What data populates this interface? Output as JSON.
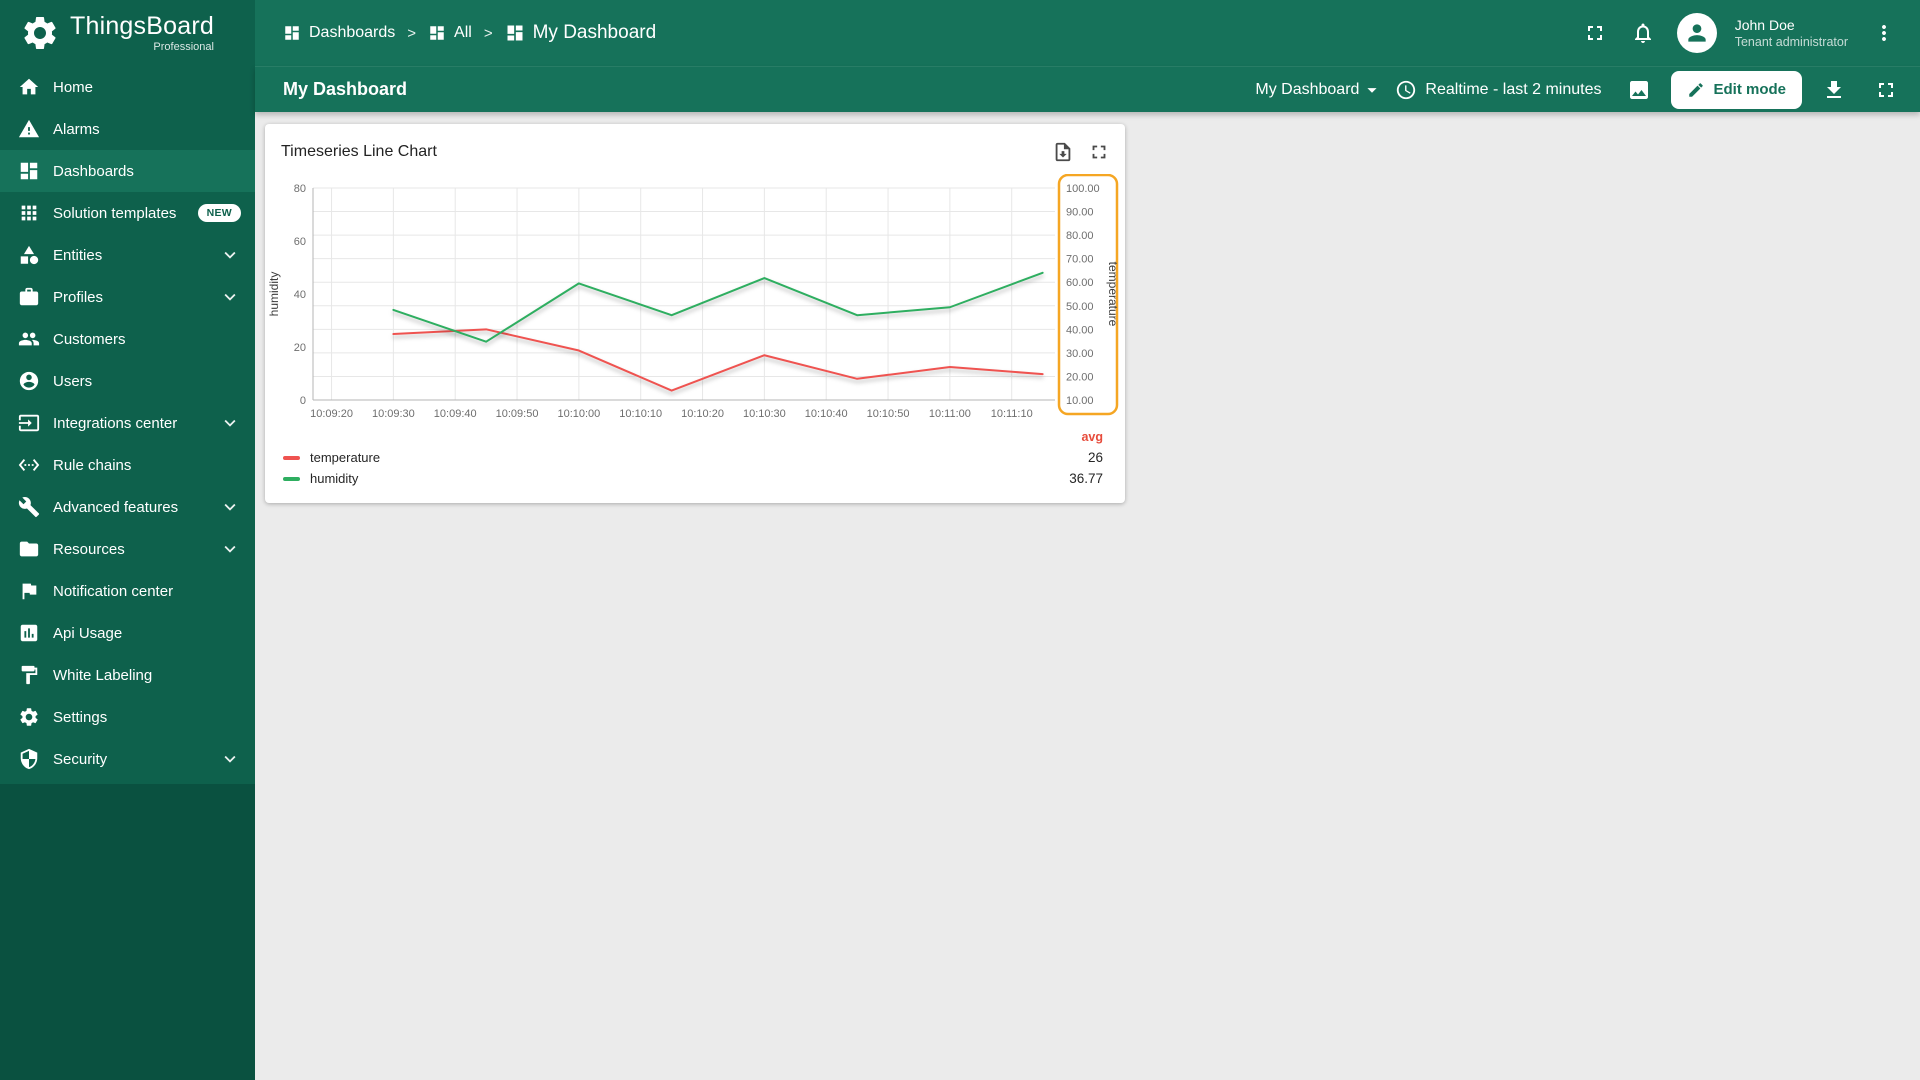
{
  "brand": {
    "name": "ThingsBoard",
    "edition": "Professional"
  },
  "sidebar": {
    "items": [
      {
        "label": "Home"
      },
      {
        "label": "Alarms"
      },
      {
        "label": "Dashboards",
        "active": true
      },
      {
        "label": "Solution templates",
        "badge": "NEW"
      },
      {
        "label": "Entities",
        "expandable": true
      },
      {
        "label": "Profiles",
        "expandable": true
      },
      {
        "label": "Customers"
      },
      {
        "label": "Users"
      },
      {
        "label": "Integrations center",
        "expandable": true
      },
      {
        "label": "Rule chains"
      },
      {
        "label": "Advanced features",
        "expandable": true
      },
      {
        "label": "Resources",
        "expandable": true
      },
      {
        "label": "Notification center"
      },
      {
        "label": "Api Usage"
      },
      {
        "label": "White Labeling"
      },
      {
        "label": "Settings"
      },
      {
        "label": "Security",
        "expandable": true
      }
    ]
  },
  "topbar": {
    "breadcrumb": [
      {
        "label": "Dashboards"
      },
      {
        "label": "All"
      },
      {
        "label": "My Dashboard"
      }
    ],
    "separator": ">",
    "user_name": "John Doe",
    "user_role": "Tenant administrator"
  },
  "dashboard_toolbar": {
    "title": "My Dashboard",
    "state_select": "My Dashboard",
    "timewindow": "Realtime - last 2 minutes",
    "edit_button": "Edit mode"
  },
  "widget": {
    "title": "Timeseries Line Chart"
  },
  "chart_data": {
    "type": "line",
    "title": "Timeseries Line Chart",
    "x_window_sec": 120,
    "x_ticks": [
      {
        "t": 3,
        "label": "10:09:20"
      },
      {
        "t": 13,
        "label": "10:09:30"
      },
      {
        "t": 23,
        "label": "10:09:40"
      },
      {
        "t": 33,
        "label": "10:09:50"
      },
      {
        "t": 43,
        "label": "10:10:00"
      },
      {
        "t": 53,
        "label": "10:10:10"
      },
      {
        "t": 63,
        "label": "10:10:20"
      },
      {
        "t": 73,
        "label": "10:10:30"
      },
      {
        "t": 83,
        "label": "10:10:40"
      },
      {
        "t": 93,
        "label": "10:10:50"
      },
      {
        "t": 103,
        "label": "10:11:00"
      },
      {
        "t": 113,
        "label": "10:11:10"
      }
    ],
    "t": [
      13,
      28,
      43,
      58,
      73,
      88,
      103,
      118
    ],
    "series": [
      {
        "name": "temperature",
        "color": "#ef5350",
        "axis": "right",
        "values": [
          38,
          40,
          31,
          14,
          29,
          19,
          24,
          21
        ],
        "avg": "26"
      },
      {
        "name": "humidity",
        "color": "#2eae60",
        "axis": "left",
        "values": [
          34,
          22,
          44,
          32,
          46,
          32,
          35,
          48
        ],
        "avg": "36.77"
      }
    ],
    "left_axis": {
      "label": "humidity",
      "min": 0,
      "max": 80,
      "ticks": [
        0,
        20,
        40,
        60,
        80
      ]
    },
    "right_axis": {
      "label": "temperature",
      "min": 10,
      "max": 100,
      "ticks": [
        10,
        20,
        30,
        40,
        50,
        60,
        70,
        80,
        90,
        100
      ],
      "decimals": 2,
      "highlight_color": "#f5a623"
    },
    "legend": {
      "avg_label": "avg",
      "avg_color": "#e74c3c"
    },
    "grid": true,
    "legend_position": "bottom"
  },
  "colors": {
    "primary": "#16725a",
    "sidebar": "#0e614c",
    "sidebar_dark": "#0a5140",
    "content_bg": "#ebebeb",
    "right_axis_highlight": "#f5a623"
  }
}
